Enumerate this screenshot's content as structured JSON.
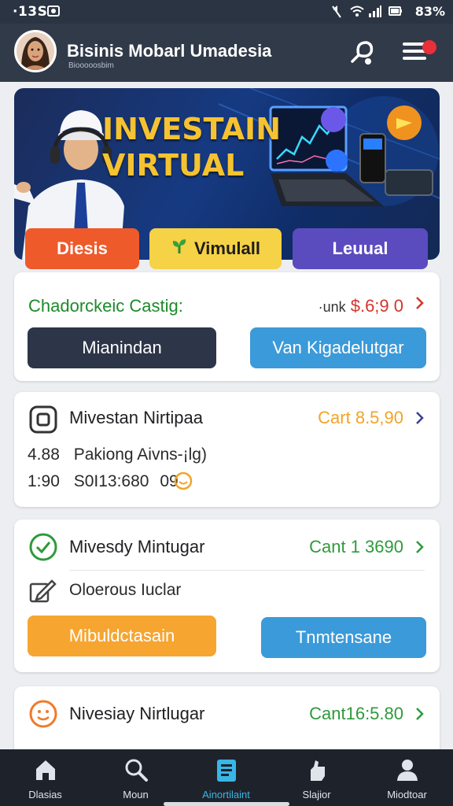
{
  "status": {
    "time": "·13S",
    "battery": "83%"
  },
  "header": {
    "title": "Bisinis Mobarl Umadesia",
    "subtitle": "Biooooosbim"
  },
  "banner": {
    "title_line1": "INVESTAIN",
    "title_line2": "VIRTUAL",
    "chips": [
      {
        "label": "Diesis",
        "color": "#ef5a2a"
      },
      {
        "label": "Vimulall",
        "color": "#f5d246"
      },
      {
        "label": "Leuual",
        "color": "#5a4bbf"
      }
    ]
  },
  "card1": {
    "title": "Chadorckeic Castig:",
    "amount_prefix": "·unk",
    "amount": "$.6;9 0",
    "buttons": [
      {
        "label": "Mianindan",
        "color": "#2d3548"
      },
      {
        "label": "Van Kigadelutgar",
        "color": "#3b9ad9"
      }
    ]
  },
  "card2": {
    "title": "Mivestan Nirtipaa",
    "amount": "Cart 8.5,90",
    "line1_num": "4.88",
    "line1_text": "Pakiong Aivns-¡lg)",
    "line2_num": "1:90",
    "line2_text": "S0I13:680",
    "line2_extra": "09"
  },
  "card3": {
    "title": "Mivesdy Mintugar",
    "amount": "Cant 1 3690",
    "item": "Oloerous Iuclar",
    "buttons": [
      {
        "label": "Mibuldctasain",
        "color": "#f6a531"
      },
      {
        "label": "Tnmtensane",
        "color": "#3b9ad9"
      }
    ]
  },
  "card4": {
    "title": "Nivesiay Nirtlugar",
    "amount": "Cant16:5.80"
  },
  "nav": [
    {
      "label": "Dlasias",
      "icon": "home-icon"
    },
    {
      "label": "Moun",
      "icon": "search-icon"
    },
    {
      "label": "Ainortilaint",
      "icon": "document-icon",
      "active": true
    },
    {
      "label": "Slajior",
      "icon": "hand-icon"
    },
    {
      "label": "Miodtoar",
      "icon": "user-icon"
    }
  ]
}
